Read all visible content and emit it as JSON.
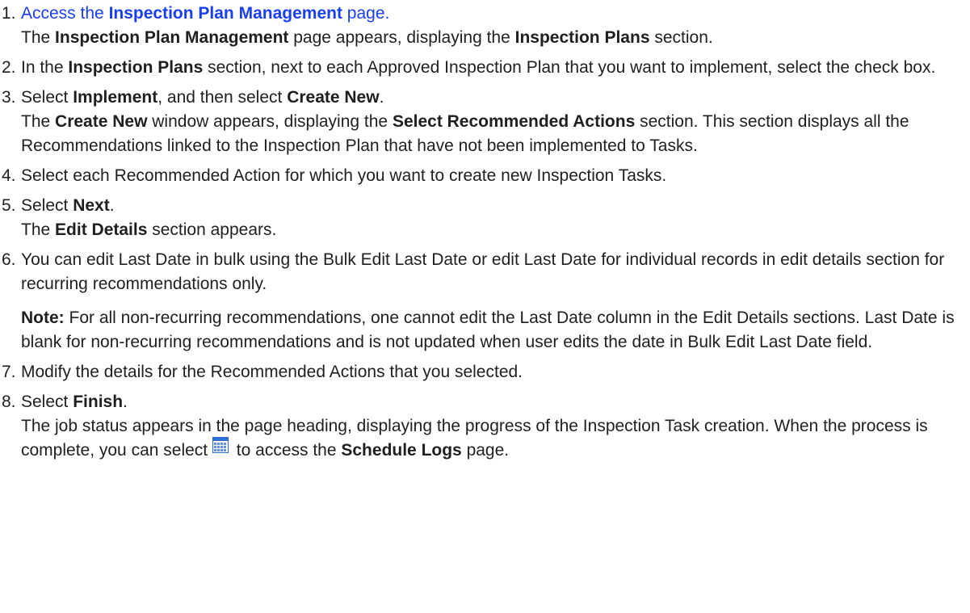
{
  "steps": [
    {
      "num": "1.",
      "link_pre": "Access the ",
      "link_bold": "Inspection Plan Management",
      "link_post": " page.",
      "r1": "The ",
      "b1": "Inspection Plan Management",
      "r2": " page appears, displaying the ",
      "b2": "Inspection Plans",
      "r3": " section."
    },
    {
      "num": "2.",
      "r1": "In the ",
      "b1": "Inspection Plans",
      "r2": " section, next to each Approved Inspection Plan that you want to implement, select the check box."
    },
    {
      "num": "3.",
      "r1": "Select ",
      "b1": "Implement",
      "r2": ", and then select ",
      "b2": "Create New",
      "r3": ".",
      "r4": "The ",
      "b3": "Create New",
      "r5": " window appears, displaying the ",
      "b4": "Select Recommended Actions",
      "r6": " section. This section displays all the Recommendations linked to the Inspection Plan that have not been implemented to Tasks."
    },
    {
      "num": "4.",
      "r1": "Select each Recommended Action for which you want to create new Inspection Tasks."
    },
    {
      "num": "5.",
      "r1": "Select ",
      "b1": "Next",
      "r2": ".",
      "b2": "The ",
      "b3": "Edit Details",
      "r3": " section appears."
    },
    {
      "num": "6.",
      "r1": "You can edit Last Date in bulk using the Bulk Edit Last Date or edit Last Date for individual records in edit details section for recurring recommendations only.",
      "note_label": "Note:",
      "note_text": " For all non-recurring recommendations, one cannot edit the Last Date column in the Edit Details sections. Last Date is blank for non-recurring recommendations and is not updated when user edits the date in Bulk Edit Last Date field."
    },
    {
      "num": "7.",
      "r1": "Modify the details for the Recommended Actions that you selected."
    },
    {
      "num": "8.",
      "r1": "Select ",
      "b1": "Finish",
      "r2": ".",
      "r3": "The job status appears in the page heading, displaying the progress of the Inspection Task creation. When the process is complete, you can select ",
      "r4": " to access the ",
      "b2": "Schedule Logs",
      "r5": " page."
    }
  ],
  "icons": {
    "schedule_logs": "calendar-icon"
  },
  "colors": {
    "link": "#1a3ff0",
    "icon_blue": "#2f6fd8"
  }
}
